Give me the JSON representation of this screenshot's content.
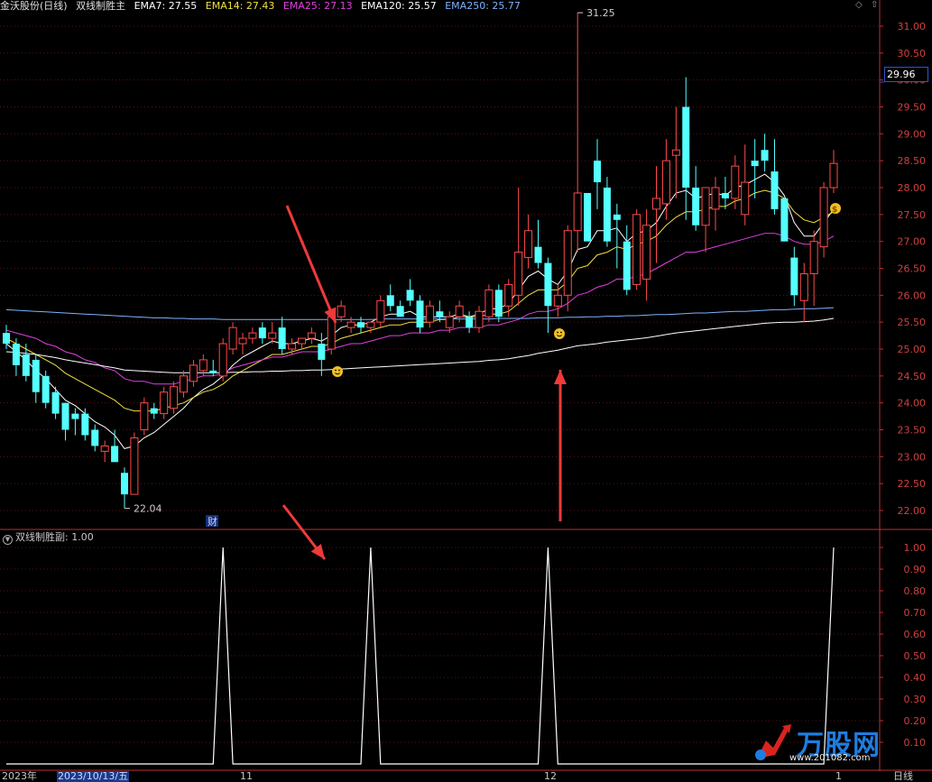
{
  "header": {
    "title": "金沃股份(日线)",
    "indicator_name": "双线制胜主",
    "ema_values": [
      {
        "label": "EMA7: 27.55",
        "color": "#ffffff"
      },
      {
        "label": "EMA14: 27.43",
        "color": "#f0e040"
      },
      {
        "label": "EMA25: 27.13",
        "color": "#e040e0"
      },
      {
        "label": "EMA120: 25.57",
        "color": "#ffffff"
      },
      {
        "label": "EMA250: 25.77",
        "color": "#7fb2ff"
      }
    ]
  },
  "sub_panel": {
    "title": "双线制胜副",
    "value": ": 1.00"
  },
  "current_price": "29.96",
  "date_axis": {
    "year_label": "2023年",
    "selected_date": "2023/10/13/五",
    "month_labels": [
      "11",
      "12",
      "1"
    ]
  },
  "period_label": "日线",
  "finance_marker": "财",
  "high_label": "31.25",
  "low_label": "22.04",
  "watermark": {
    "brand": "万股网",
    "url": "www.201082.com"
  },
  "colors": {
    "up": "#ff4a4a",
    "down": "#54ffff",
    "axis": "#c03030",
    "ema7": "#ffffff",
    "ema14": "#f0e040",
    "ema25": "#e040e0",
    "ema120": "#ffffff",
    "ema250": "#7fb2ff",
    "arrow": "#ee3a3a"
  },
  "chart_data": [
    {
      "type": "candlestick",
      "title": "金沃股份(日线)",
      "ylim": [
        21.75,
        31.35
      ],
      "yticks": [
        22.0,
        22.5,
        23.0,
        23.5,
        24.0,
        24.5,
        25.0,
        25.5,
        26.0,
        26.5,
        27.0,
        27.5,
        28.0,
        28.5,
        29.0,
        29.5,
        30.0,
        30.5,
        31.0
      ],
      "candles": [
        {
          "o": 25.3,
          "h": 25.45,
          "l": 25.0,
          "c": 25.1
        },
        {
          "o": 25.1,
          "h": 25.2,
          "l": 24.5,
          "c": 24.7
        },
        {
          "o": 24.9,
          "h": 25.1,
          "l": 24.4,
          "c": 24.5
        },
        {
          "o": 24.8,
          "h": 24.9,
          "l": 24.0,
          "c": 24.2
        },
        {
          "o": 24.5,
          "h": 24.6,
          "l": 23.9,
          "c": 24.0
        },
        {
          "o": 24.2,
          "h": 24.3,
          "l": 23.7,
          "c": 23.8
        },
        {
          "o": 24.0,
          "h": 24.0,
          "l": 23.3,
          "c": 23.5
        },
        {
          "o": 23.8,
          "h": 23.9,
          "l": 23.4,
          "c": 23.7
        },
        {
          "o": 23.8,
          "h": 23.9,
          "l": 23.3,
          "c": 23.4
        },
        {
          "o": 23.5,
          "h": 23.6,
          "l": 23.1,
          "c": 23.2
        },
        {
          "o": 23.1,
          "h": 23.3,
          "l": 22.9,
          "c": 23.2
        },
        {
          "o": 23.2,
          "h": 23.5,
          "l": 22.9,
          "c": 22.9
        },
        {
          "o": 22.7,
          "h": 22.8,
          "l": 22.04,
          "c": 22.3
        },
        {
          "o": 22.3,
          "h": 23.45,
          "l": 22.3,
          "c": 23.35
        },
        {
          "o": 23.5,
          "h": 24.1,
          "l": 23.4,
          "c": 24.0
        },
        {
          "o": 23.9,
          "h": 24.0,
          "l": 23.7,
          "c": 23.8
        },
        {
          "o": 23.8,
          "h": 24.3,
          "l": 23.7,
          "c": 24.2
        },
        {
          "o": 23.9,
          "h": 24.4,
          "l": 23.8,
          "c": 24.3
        },
        {
          "o": 24.2,
          "h": 24.6,
          "l": 24.1,
          "c": 24.5
        },
        {
          "o": 24.4,
          "h": 24.8,
          "l": 24.3,
          "c": 24.7
        },
        {
          "o": 24.6,
          "h": 24.9,
          "l": 24.5,
          "c": 24.8
        },
        {
          "o": 24.6,
          "h": 24.8,
          "l": 24.5,
          "c": 24.55
        },
        {
          "o": 24.5,
          "h": 25.2,
          "l": 24.4,
          "c": 25.1
        },
        {
          "o": 25.0,
          "h": 25.5,
          "l": 24.9,
          "c": 25.4
        },
        {
          "o": 25.1,
          "h": 25.3,
          "l": 24.9,
          "c": 25.2
        },
        {
          "o": 25.2,
          "h": 25.4,
          "l": 25.1,
          "c": 25.3
        },
        {
          "o": 25.4,
          "h": 25.5,
          "l": 25.1,
          "c": 25.2
        },
        {
          "o": 25.2,
          "h": 25.5,
          "l": 25.1,
          "c": 25.3
        },
        {
          "o": 25.4,
          "h": 25.6,
          "l": 24.9,
          "c": 25.0
        },
        {
          "o": 25.0,
          "h": 25.2,
          "l": 24.9,
          "c": 25.1
        },
        {
          "o": 25.1,
          "h": 25.2,
          "l": 25.0,
          "c": 25.2
        },
        {
          "o": 25.2,
          "h": 25.4,
          "l": 25.1,
          "c": 25.3
        },
        {
          "o": 25.1,
          "h": 25.3,
          "l": 24.5,
          "c": 24.8
        },
        {
          "o": 25.0,
          "h": 25.7,
          "l": 24.9,
          "c": 25.6
        },
        {
          "o": 25.6,
          "h": 25.9,
          "l": 25.5,
          "c": 25.8
        },
        {
          "o": 25.4,
          "h": 25.6,
          "l": 25.3,
          "c": 25.5
        },
        {
          "o": 25.5,
          "h": 25.6,
          "l": 25.3,
          "c": 25.4
        },
        {
          "o": 25.4,
          "h": 25.5,
          "l": 25.3,
          "c": 25.5
        },
        {
          "o": 25.5,
          "h": 26.0,
          "l": 25.4,
          "c": 25.9
        },
        {
          "o": 26.0,
          "h": 26.2,
          "l": 25.7,
          "c": 25.8
        },
        {
          "o": 25.8,
          "h": 25.9,
          "l": 25.6,
          "c": 25.6
        },
        {
          "o": 26.1,
          "h": 26.3,
          "l": 25.8,
          "c": 25.9
        },
        {
          "o": 25.9,
          "h": 26.0,
          "l": 25.3,
          "c": 25.4
        },
        {
          "o": 25.5,
          "h": 25.9,
          "l": 25.4,
          "c": 25.8
        },
        {
          "o": 25.7,
          "h": 25.9,
          "l": 25.5,
          "c": 25.6
        },
        {
          "o": 25.4,
          "h": 25.7,
          "l": 25.3,
          "c": 25.6
        },
        {
          "o": 25.6,
          "h": 25.9,
          "l": 25.5,
          "c": 25.8
        },
        {
          "o": 25.6,
          "h": 25.7,
          "l": 25.3,
          "c": 25.4
        },
        {
          "o": 25.4,
          "h": 25.8,
          "l": 25.3,
          "c": 25.7
        },
        {
          "o": 25.6,
          "h": 26.2,
          "l": 25.5,
          "c": 26.1
        },
        {
          "o": 26.1,
          "h": 26.2,
          "l": 25.5,
          "c": 25.6
        },
        {
          "o": 25.8,
          "h": 26.3,
          "l": 25.6,
          "c": 26.2
        },
        {
          "o": 26.0,
          "h": 28.0,
          "l": 25.8,
          "c": 26.8
        },
        {
          "o": 26.7,
          "h": 27.5,
          "l": 26.5,
          "c": 27.2
        },
        {
          "o": 26.9,
          "h": 27.4,
          "l": 26.5,
          "c": 26.6
        },
        {
          "o": 26.6,
          "h": 26.7,
          "l": 25.3,
          "c": 25.8
        },
        {
          "o": 25.8,
          "h": 26.2,
          "l": 25.6,
          "c": 26.0
        },
        {
          "o": 26.0,
          "h": 27.3,
          "l": 25.7,
          "c": 27.2
        },
        {
          "o": 27.2,
          "h": 31.25,
          "l": 26.8,
          "c": 27.9
        },
        {
          "o": 27.9,
          "h": 27.9,
          "l": 27.1,
          "c": 27.0
        },
        {
          "o": 28.5,
          "h": 28.9,
          "l": 27.6,
          "c": 28.1
        },
        {
          "o": 28.0,
          "h": 28.2,
          "l": 26.9,
          "c": 27.0
        },
        {
          "o": 27.5,
          "h": 27.7,
          "l": 26.5,
          "c": 27.4
        },
        {
          "o": 27.0,
          "h": 27.3,
          "l": 26.0,
          "c": 26.1
        },
        {
          "o": 26.2,
          "h": 27.6,
          "l": 26.1,
          "c": 27.5
        },
        {
          "o": 26.3,
          "h": 27.6,
          "l": 25.9,
          "c": 27.3
        },
        {
          "o": 27.6,
          "h": 28.4,
          "l": 26.6,
          "c": 27.8
        },
        {
          "o": 27.7,
          "h": 28.9,
          "l": 27.4,
          "c": 28.5
        },
        {
          "o": 28.6,
          "h": 29.5,
          "l": 27.8,
          "c": 28.7
        },
        {
          "o": 29.5,
          "h": 30.05,
          "l": 27.4,
          "c": 28.0
        },
        {
          "o": 28.0,
          "h": 28.4,
          "l": 27.2,
          "c": 27.3
        },
        {
          "o": 27.3,
          "h": 28.0,
          "l": 26.8,
          "c": 28.0
        },
        {
          "o": 27.6,
          "h": 28.2,
          "l": 27.2,
          "c": 28.0
        },
        {
          "o": 27.9,
          "h": 28.2,
          "l": 27.6,
          "c": 27.8
        },
        {
          "o": 27.8,
          "h": 28.6,
          "l": 27.6,
          "c": 28.4
        },
        {
          "o": 27.5,
          "h": 28.8,
          "l": 27.3,
          "c": 28.1
        },
        {
          "o": 28.5,
          "h": 28.9,
          "l": 27.8,
          "c": 28.4
        },
        {
          "o": 28.7,
          "h": 29.0,
          "l": 28.3,
          "c": 28.5
        },
        {
          "o": 28.3,
          "h": 28.9,
          "l": 27.5,
          "c": 27.6
        },
        {
          "o": 27.8,
          "h": 27.8,
          "l": 27.0,
          "c": 27.0
        },
        {
          "o": 26.7,
          "h": 26.9,
          "l": 25.8,
          "c": 26.0
        },
        {
          "o": 25.9,
          "h": 26.6,
          "l": 25.5,
          "c": 26.4
        },
        {
          "o": 26.4,
          "h": 27.2,
          "l": 25.8,
          "c": 27.0
        },
        {
          "o": 26.9,
          "h": 28.1,
          "l": 26.7,
          "c": 28.0
        },
        {
          "o": 28.0,
          "h": 28.7,
          "l": 27.9,
          "c": 28.45
        }
      ],
      "series": [
        {
          "name": "EMA7",
          "color": "#ffffff",
          "values": [
            25.1,
            24.95,
            24.8,
            24.6,
            24.45,
            24.25,
            24.05,
            23.95,
            23.8,
            23.65,
            23.55,
            23.4,
            23.15,
            23.2,
            23.35,
            23.45,
            23.6,
            23.75,
            23.9,
            24.1,
            24.25,
            24.35,
            24.5,
            24.7,
            24.85,
            24.95,
            25.05,
            25.15,
            25.1,
            25.1,
            25.15,
            25.2,
            25.15,
            25.25,
            25.4,
            25.45,
            25.45,
            25.5,
            25.6,
            25.65,
            25.65,
            25.7,
            25.6,
            25.6,
            25.6,
            25.6,
            25.65,
            25.6,
            25.65,
            25.75,
            25.75,
            25.85,
            26.1,
            26.35,
            26.45,
            26.3,
            26.2,
            26.45,
            26.85,
            26.9,
            27.2,
            27.2,
            27.25,
            27.0,
            27.15,
            27.2,
            27.35,
            27.65,
            27.9,
            27.95,
            27.8,
            27.85,
            27.9,
            27.85,
            28.0,
            28.05,
            28.15,
            28.25,
            28.1,
            27.85,
            27.35,
            27.1,
            27.1,
            27.35,
            27.6
          ]
        },
        {
          "name": "EMA14",
          "color": "#f0e040",
          "values": [
            25.2,
            25.1,
            25.0,
            24.9,
            24.8,
            24.7,
            24.55,
            24.45,
            24.35,
            24.25,
            24.15,
            24.05,
            23.9,
            23.85,
            23.85,
            23.85,
            23.9,
            23.95,
            24.0,
            24.1,
            24.2,
            24.25,
            24.35,
            24.5,
            24.6,
            24.7,
            24.8,
            24.9,
            24.9,
            24.95,
            25.0,
            25.05,
            25.05,
            25.1,
            25.2,
            25.25,
            25.3,
            25.35,
            25.4,
            25.45,
            25.45,
            25.5,
            25.5,
            25.5,
            25.55,
            25.55,
            25.6,
            25.6,
            25.6,
            25.65,
            25.65,
            25.7,
            25.85,
            26.0,
            26.1,
            26.1,
            26.1,
            26.25,
            26.5,
            26.55,
            26.75,
            26.8,
            26.9,
            26.85,
            26.95,
            27.0,
            27.1,
            27.3,
            27.45,
            27.55,
            27.55,
            27.6,
            27.65,
            27.65,
            27.75,
            27.8,
            27.9,
            27.95,
            27.9,
            27.8,
            27.55,
            27.4,
            27.35,
            27.45,
            27.55
          ]
        },
        {
          "name": "EMA25",
          "color": "#e040e0",
          "values": [
            25.35,
            25.3,
            25.25,
            25.2,
            25.1,
            25.05,
            24.95,
            24.9,
            24.8,
            24.75,
            24.65,
            24.6,
            24.45,
            24.4,
            24.4,
            24.35,
            24.35,
            24.35,
            24.4,
            24.45,
            24.5,
            24.5,
            24.55,
            24.65,
            24.7,
            24.75,
            24.8,
            24.85,
            24.85,
            24.9,
            24.95,
            24.95,
            24.95,
            25.0,
            25.05,
            25.1,
            25.1,
            25.15,
            25.2,
            25.25,
            25.25,
            25.3,
            25.3,
            25.3,
            25.35,
            25.35,
            25.4,
            25.4,
            25.4,
            25.45,
            25.45,
            25.5,
            25.55,
            25.65,
            25.7,
            25.7,
            25.75,
            25.85,
            26.0,
            26.05,
            26.15,
            26.2,
            26.3,
            26.3,
            26.35,
            26.4,
            26.5,
            26.6,
            26.7,
            26.8,
            26.8,
            26.85,
            26.9,
            26.95,
            27.0,
            27.05,
            27.1,
            27.15,
            27.15,
            27.1,
            27.0,
            26.95,
            26.95,
            27.0,
            27.1
          ]
        },
        {
          "name": "EMA120",
          "color": "#ffffff",
          "values": [
            24.95,
            24.94,
            24.92,
            24.9,
            24.87,
            24.84,
            24.8,
            24.77,
            24.74,
            24.71,
            24.68,
            24.65,
            24.61,
            24.6,
            24.59,
            24.58,
            24.57,
            24.56,
            24.56,
            24.56,
            24.56,
            24.56,
            24.56,
            24.57,
            24.57,
            24.58,
            24.58,
            24.59,
            24.59,
            24.6,
            24.6,
            24.61,
            24.61,
            24.62,
            24.63,
            24.64,
            24.65,
            24.66,
            24.67,
            24.68,
            24.69,
            24.7,
            24.71,
            24.72,
            24.73,
            24.74,
            24.75,
            24.76,
            24.77,
            24.79,
            24.8,
            24.82,
            24.85,
            24.88,
            24.92,
            24.95,
            24.98,
            25.02,
            25.06,
            25.08,
            25.1,
            25.13,
            25.15,
            25.17,
            25.19,
            25.21,
            25.24,
            25.27,
            25.3,
            25.32,
            25.34,
            25.36,
            25.38,
            25.4,
            25.42,
            25.44,
            25.46,
            25.48,
            25.49,
            25.5,
            25.5,
            25.51,
            25.52,
            25.54,
            25.57
          ]
        },
        {
          "name": "EMA250",
          "color": "#7fb2ff",
          "values": [
            25.73,
            25.72,
            25.71,
            25.7,
            25.69,
            25.68,
            25.67,
            25.66,
            25.65,
            25.64,
            25.63,
            25.62,
            25.61,
            25.6,
            25.59,
            25.58,
            25.58,
            25.57,
            25.57,
            25.56,
            25.56,
            25.56,
            25.55,
            25.55,
            25.55,
            25.55,
            25.55,
            25.55,
            25.55,
            25.55,
            25.55,
            25.55,
            25.55,
            25.55,
            25.55,
            25.55,
            25.55,
            25.55,
            25.56,
            25.56,
            25.56,
            25.56,
            25.56,
            25.56,
            25.56,
            25.56,
            25.56,
            25.56,
            25.56,
            25.56,
            25.57,
            25.57,
            25.57,
            25.57,
            25.58,
            25.58,
            25.58,
            25.59,
            25.59,
            25.6,
            25.6,
            25.61,
            25.61,
            25.62,
            25.62,
            25.63,
            25.64,
            25.64,
            25.65,
            25.66,
            25.67,
            25.67,
            25.68,
            25.69,
            25.7,
            25.7,
            25.71,
            25.72,
            25.73,
            25.73,
            25.74,
            25.75,
            25.75,
            25.76,
            25.77
          ]
        }
      ]
    },
    {
      "type": "line",
      "title": "双线制胜副",
      "ylim": [
        0,
        1.05
      ],
      "yticks": [
        0.1,
        0.2,
        0.3,
        0.4,
        0.5,
        0.6,
        0.7,
        0.8,
        0.9,
        1.0
      ],
      "tick_labels": [
        "0.10",
        "0.20",
        "0.30",
        "0.40",
        "0.50",
        "0.60",
        "0.70",
        "0.80",
        "0.90",
        "1.00"
      ],
      "series": [
        {
          "name": "双线制胜副",
          "color": "#ffffff",
          "values_sparse": {
            "22": 1,
            "37": 1,
            "55": 1,
            "84": 1
          }
        }
      ]
    }
  ]
}
